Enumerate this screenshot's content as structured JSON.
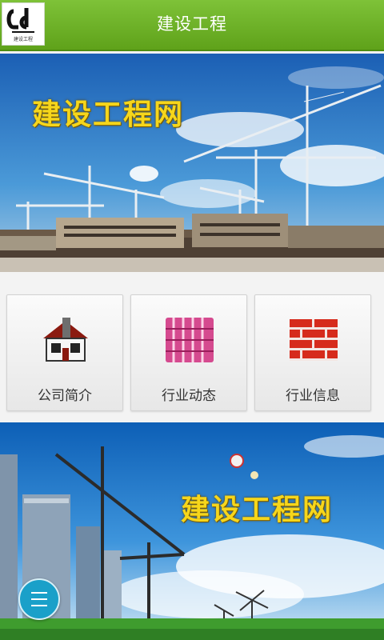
{
  "header": {
    "title": "建设工程",
    "logo_caption": "建设工程"
  },
  "banner_top": {
    "caption": "建设工程网"
  },
  "tiles": [
    {
      "label": "公司简介",
      "icon": "house-icon"
    },
    {
      "label": "行业动态",
      "icon": "roof-tiles-icon"
    },
    {
      "label": "行业信息",
      "icon": "brick-wall-icon"
    }
  ],
  "banner_bottom": {
    "caption": "建设工程网"
  },
  "menu": {
    "icon": "hamburger-menu-icon"
  },
  "colors": {
    "header_green": "#6db52a",
    "caption_yellow": "#f6d61b",
    "menu_blue": "#1aa0c9"
  }
}
